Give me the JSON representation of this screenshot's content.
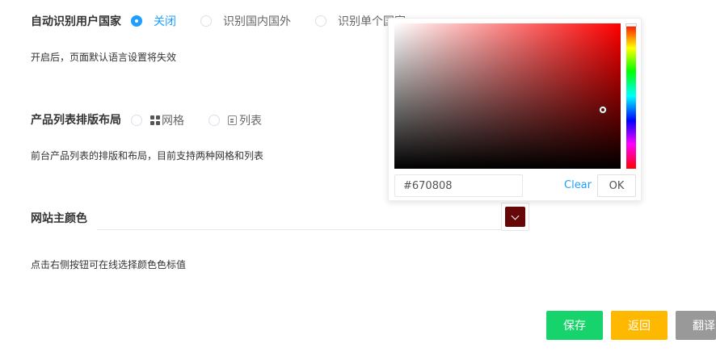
{
  "country_detect": {
    "label": "自动识别用户国家",
    "options": [
      {
        "label": "关闭",
        "checked": true
      },
      {
        "label": "识别国内国外",
        "checked": false
      },
      {
        "label": "识别单个国家",
        "checked": false
      }
    ],
    "hint": "开启后，页面默认语言设置将失效"
  },
  "list_layout": {
    "label": "产品列表排版布局",
    "options": [
      {
        "label": "网格",
        "icon": "grid-icon",
        "checked": false
      },
      {
        "label": "列表",
        "icon": "list-icon",
        "checked": false
      }
    ],
    "hint": "前台产品列表的排版和布局，目前支持两种网格和列表"
  },
  "theme_color": {
    "label": "网站主颜色",
    "value": "#670808",
    "icon": "chevron-down-icon",
    "hint": "点击右侧按钮可在线选择颜色色标值"
  },
  "color_picker": {
    "hue_color": "#ff0000",
    "hex_value": "#670808",
    "clear_label": "Clear",
    "ok_label": "OK"
  },
  "actions": {
    "save_label": "保存",
    "back_label": "返回",
    "translate_label": "翻译"
  },
  "colors": {
    "accent": "#1e9fff",
    "save": "#16d46b",
    "back": "#ffb800",
    "translate": "#999999"
  }
}
